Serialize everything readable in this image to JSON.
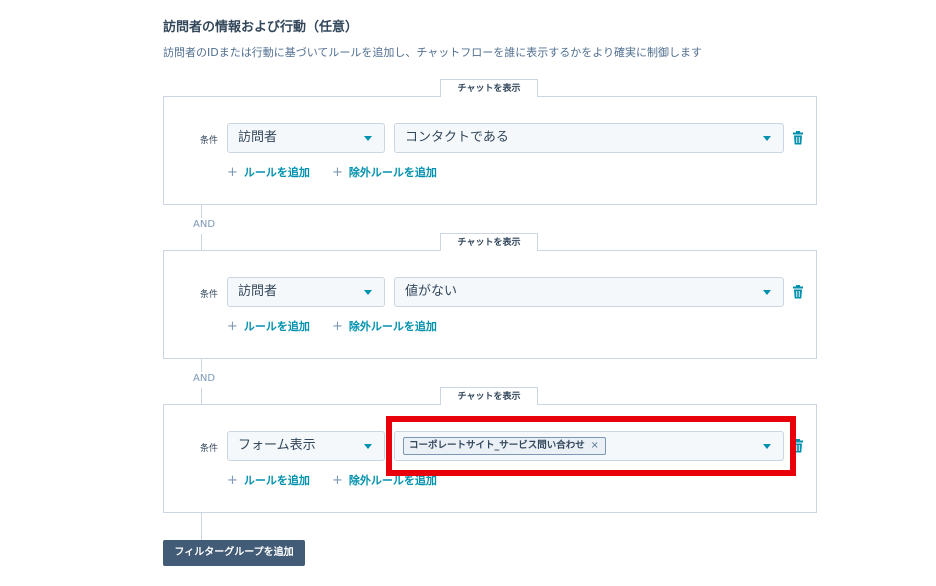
{
  "header": {
    "title": "訪問者の情報および行動（任意）",
    "description": "訪問者のIDまたは行動に基づいてルールを追加し、チャットフローを誰に表示するかをより確実に制御します"
  },
  "tab_label": "チャットを表示",
  "and_label": "AND",
  "condition_label": "条件",
  "add_rule_label": "ルールを追加",
  "add_exclusion_rule_label": "除外ルールを追加",
  "groups": [
    {
      "property": "訪問者",
      "operator": "コンタクトである"
    },
    {
      "property": "訪問者",
      "operator": "値がない"
    },
    {
      "property": "フォーム表示",
      "selected_tag": "コーポレートサイト_サービス問い合わせ"
    }
  ],
  "add_filter_group_label": "フィルターグループを追加",
  "colors": {
    "accent": "#0091ae",
    "highlight": "#e8000b",
    "button": "#425b76"
  }
}
